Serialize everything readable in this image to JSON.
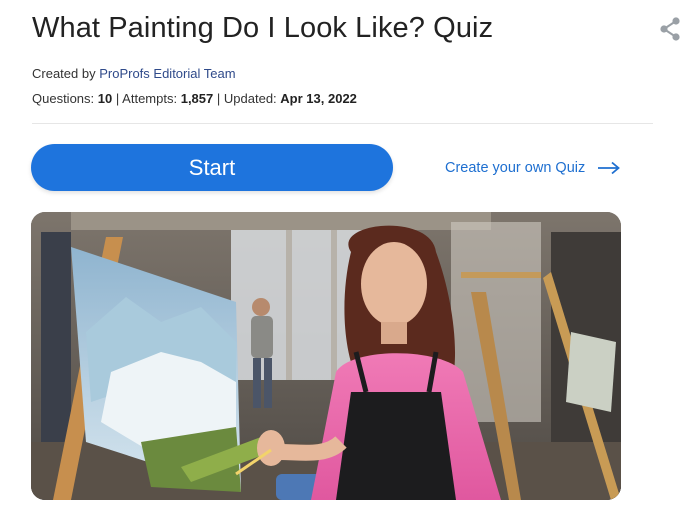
{
  "quiz": {
    "title": "What Painting Do I Look Like? Quiz",
    "created_prefix": "Created by",
    "author": "ProProfs Editorial Team",
    "questions_label": "Questions:",
    "questions_value": "10",
    "attempts_label": "Attempts:",
    "attempts_value": "1,857",
    "updated_label": "Updated:",
    "updated_value": "Apr 13, 2022",
    "separator": "|"
  },
  "actions": {
    "start_label": "Start",
    "create_label": "Create your own Quiz"
  },
  "icons": {
    "share": "share-icon",
    "arrow": "arrow-right-icon"
  },
  "colors": {
    "accent": "#1e74dd",
    "link": "#1e6fd0",
    "author": "#2f4a8a"
  }
}
